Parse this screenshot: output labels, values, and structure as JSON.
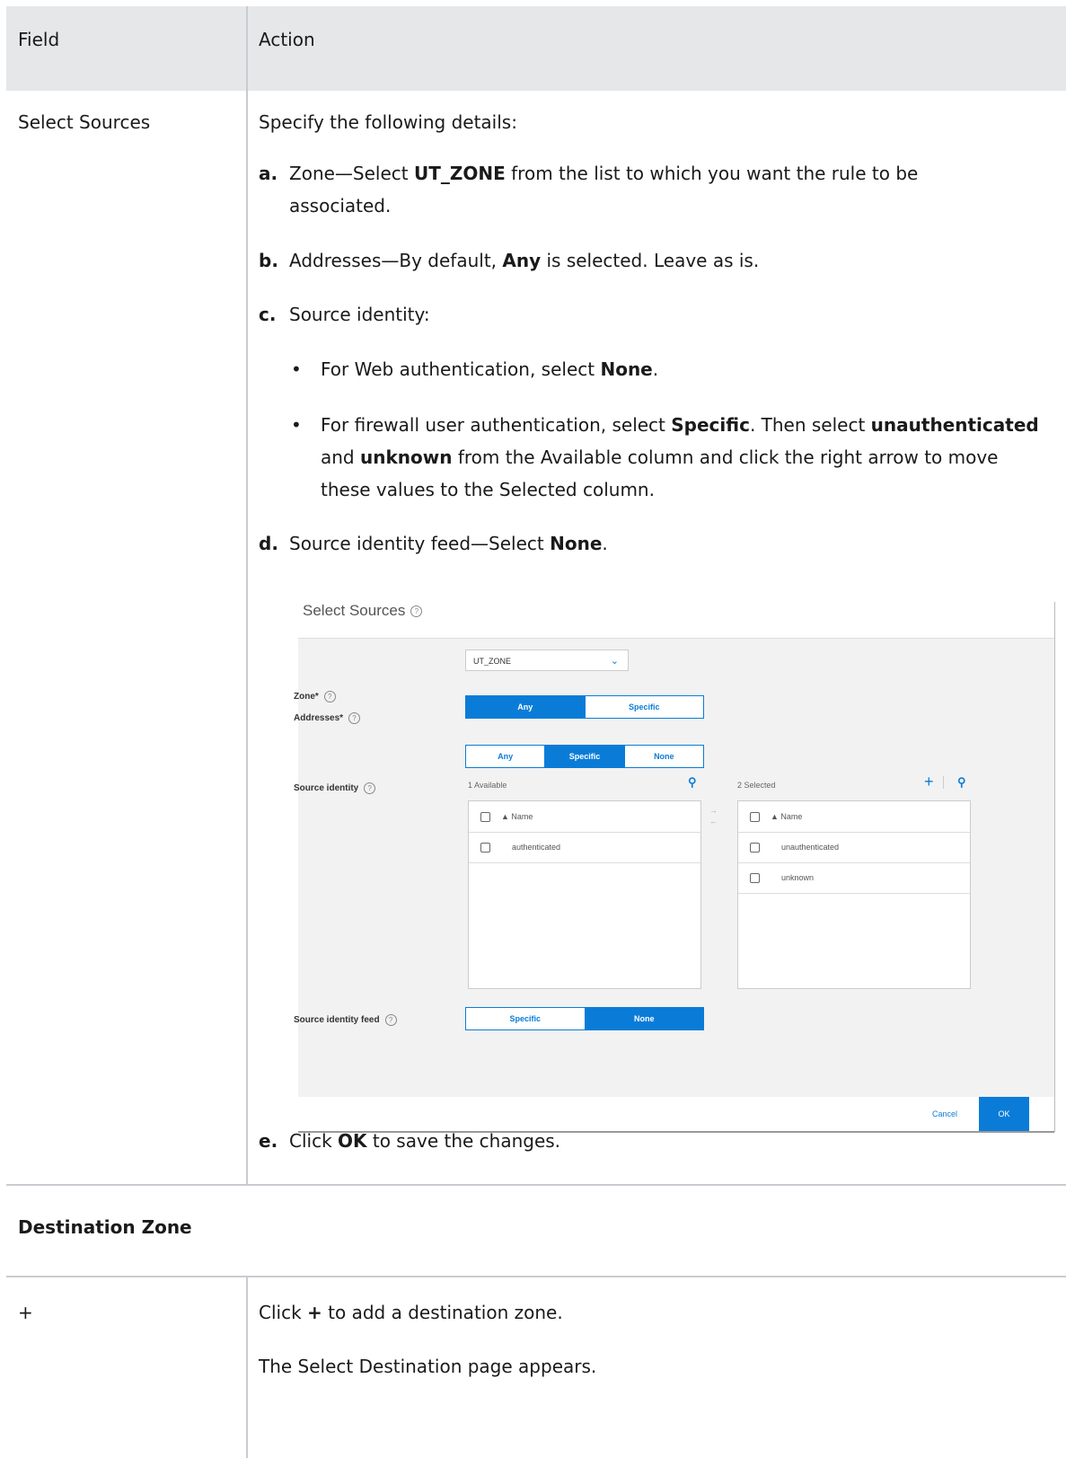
{
  "table": {
    "header_field": "Field",
    "header_action": "Action",
    "row1_field": "Select Sources",
    "row1_intro": "Specify the following details:",
    "item_a": {
      "letter": "a.",
      "pre": "Zone—Select ",
      "bold": "UT_ZONE",
      "post": " from the list to which you want the rule to be",
      "cont": "associated."
    },
    "item_b": {
      "letter": "b.",
      "pre": "Addresses—By default, ",
      "bold": "Any",
      "post": " is selected. Leave as is."
    },
    "item_c": {
      "letter": "c.",
      "text": "Source identity:"
    },
    "bullet1": {
      "pre": "For Web authentication, select ",
      "bold": "None",
      "post": "."
    },
    "bullet2": {
      "l1_pre": "For firewall user authentication, select ",
      "l1_b1": "Specific",
      "l1_mid": ". Then select ",
      "l1_b2": "unauthenticated",
      "l2_pre": "and ",
      "l2_b": "unknown",
      "l2_post": " from the Available column and click the right arrow to move",
      "l3": "these values to the Selected column."
    },
    "item_d": {
      "letter": "d.",
      "pre": "Source identity feed—Select ",
      "bold": "None",
      "post": "."
    },
    "item_e": {
      "letter": "e.",
      "pre": "Click ",
      "bold": "OK",
      "post": " to save the changes."
    },
    "section2_title": "Destination Zone",
    "row2_field": "+",
    "row2_p1_pre": "Click ",
    "row2_p1_bold": "+",
    "row2_p1_post": " to add a destination zone.",
    "row2_p2": "The Select Destination page appears."
  },
  "dialog": {
    "title": "Select Sources",
    "zone_label": "Zone*",
    "zone_value": "UT_ZONE",
    "addresses_label": "Addresses*",
    "addresses_options": [
      "Any",
      "Specific"
    ],
    "source_identity_label": "Source identity",
    "source_identity_options": [
      "Any",
      "Specific",
      "None"
    ],
    "available_count": "1 Available",
    "selected_count": "2 Selected",
    "col_name": "Name",
    "available_items": [
      "authenticated"
    ],
    "selected_items": [
      "unauthenticated",
      "unknown"
    ],
    "feed_label": "Source identity feed",
    "feed_options": [
      "Specific",
      "None"
    ],
    "cancel": "Cancel",
    "ok": "OK"
  }
}
